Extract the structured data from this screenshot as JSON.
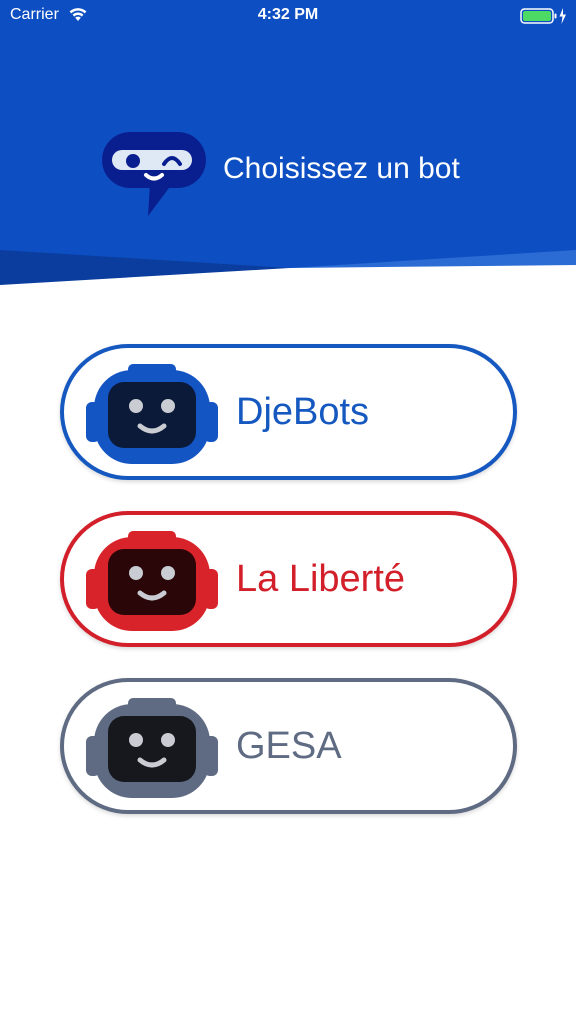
{
  "status_bar": {
    "carrier": "Carrier",
    "time": "4:32 PM"
  },
  "header": {
    "title": "Choisissez un bot",
    "icon": "chatbot-icon"
  },
  "colors": {
    "header_blue": "#0d4fc2",
    "header_dark": "#0a3d9e",
    "header_light": "#2a6bd4",
    "battery_green": "#4cd964"
  },
  "bots": [
    {
      "label": "DjeBots",
      "icon": "robot-head-icon",
      "color": "#1558c0",
      "frame": "#1455c4",
      "face": "#0b1a38"
    },
    {
      "label": "La Liberté",
      "icon": "robot-head-icon",
      "color": "#d21f2a",
      "frame": "#d9232b",
      "face": "#2a0608"
    },
    {
      "label": "GESA",
      "icon": "robot-head-icon",
      "color": "#5f6b82",
      "frame": "#5f6b82",
      "face": "#16181d"
    }
  ]
}
